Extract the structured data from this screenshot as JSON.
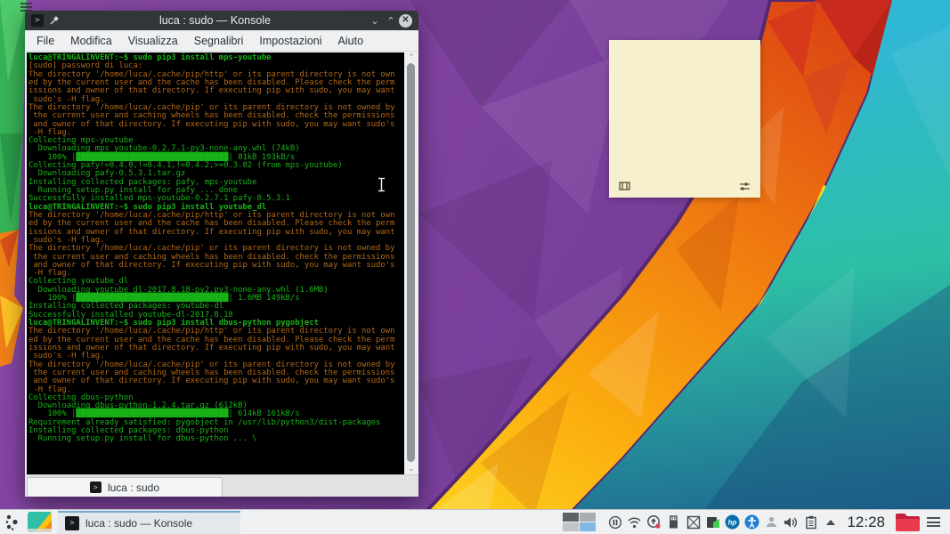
{
  "desktop": {
    "toolbox_icon": "hamburger-icon",
    "wallpaper_colors": {
      "purple": "#7f3f9e",
      "orange": "#f07c10",
      "yellow": "#fdd11d",
      "teal": "#2dbfa6",
      "blue": "#1d5f8e",
      "red": "#c92a1e",
      "green": "#37b457"
    }
  },
  "konsole": {
    "title": "luca : sudo — Konsole",
    "titlebar_buttons": {
      "minimize": "⌄",
      "maximize": "⌃",
      "close": "✕"
    },
    "menu": [
      "File",
      "Modifica",
      "Visualizza",
      "Segnalibri",
      "Impostazioni",
      "Aiuto"
    ],
    "tab_label": "luca : sudo",
    "terminal_lines": [
      {
        "c": "b",
        "t": "luca@TRINGALINVENT:~$ sudo pip3 install mps-youtube"
      },
      {
        "c": "y",
        "t": "[sudo] password di luca:"
      },
      {
        "c": "y",
        "t": "The directory '/home/luca/.cache/pip/http' or its parent directory is not own"
      },
      {
        "c": "y",
        "t": "ed by the current user and the cache has been disabled. Please check the perm"
      },
      {
        "c": "y",
        "t": "issions and owner of that directory. If executing pip with sudo, you may want"
      },
      {
        "c": "y",
        "t": " sudo's -H flag."
      },
      {
        "c": "y",
        "t": "The directory '/home/luca/.cache/pip' or its parent directory is not owned by"
      },
      {
        "c": "y",
        "t": " the current user and caching wheels has been disabled. check the permissions"
      },
      {
        "c": "y",
        "t": " and owner of that directory. If executing pip with sudo, you may want sudo's"
      },
      {
        "c": "y",
        "t": " -H flag."
      },
      {
        "c": "g",
        "t": "Collecting mps-youtube"
      },
      {
        "c": "g",
        "t": "  Downloading mps_youtube-0.2.7.1-py3-none-any.whl (74kB)"
      },
      {
        "c": "g",
        "t": "    100% |████████████████████████████████| 81kB 193kB/s "
      },
      {
        "c": "g",
        "t": "Collecting pafy!=0.4.0,!=0.4.1,!=0.4.2,>=0.3.82 (from mps-youtube)"
      },
      {
        "c": "g",
        "t": "  Downloading pafy-0.5.3.1.tar.gz"
      },
      {
        "c": "g",
        "t": "Installing collected packages: pafy, mps-youtube"
      },
      {
        "c": "g",
        "t": "  Running setup.py install for pafy ... done"
      },
      {
        "c": "g",
        "t": "Successfully installed mps-youtube-0.2.7.1 pafy-0.5.3.1"
      },
      {
        "c": "b",
        "t": "luca@TRINGALINVENT:~$ sudo pip3 install youtube_dl"
      },
      {
        "c": "y",
        "t": "The directory '/home/luca/.cache/pip/http' or its parent directory is not own"
      },
      {
        "c": "y",
        "t": "ed by the current user and the cache has been disabled. Please check the perm"
      },
      {
        "c": "y",
        "t": "issions and owner of that directory. If executing pip with sudo, you may want"
      },
      {
        "c": "y",
        "t": " sudo's -H flag."
      },
      {
        "c": "y",
        "t": "The directory '/home/luca/.cache/pip' or its parent directory is not owned by"
      },
      {
        "c": "y",
        "t": " the current user and caching wheels has been disabled. check the permissions"
      },
      {
        "c": "y",
        "t": " and owner of that directory. If executing pip with sudo, you may want sudo's"
      },
      {
        "c": "y",
        "t": " -H flag."
      },
      {
        "c": "g",
        "t": "Collecting youtube_dl"
      },
      {
        "c": "g",
        "t": "  Downloading youtube_dl-2017.8.18-py2.py3-none-any.whl (1.6MB)"
      },
      {
        "c": "g",
        "t": "    100% |████████████████████████████████| 1.6MB 149kB/s "
      },
      {
        "c": "g",
        "t": "Installing collected packages: youtube-dl"
      },
      {
        "c": "g",
        "t": "Successfully installed youtube-dl-2017.8.18"
      },
      {
        "c": "b",
        "t": "luca@TRINGALINVENT:~$ sudo pip3 install dbus-python pygobject"
      },
      {
        "c": "y",
        "t": "The directory '/home/luca/.cache/pip/http' or its parent directory is not own"
      },
      {
        "c": "y",
        "t": "ed by the current user and the cache has been disabled. Please check the perm"
      },
      {
        "c": "y",
        "t": "issions and owner of that directory. If executing pip with sudo, you may want"
      },
      {
        "c": "y",
        "t": " sudo's -H flag."
      },
      {
        "c": "y",
        "t": "The directory '/home/luca/.cache/pip' or its parent directory is not owned by"
      },
      {
        "c": "y",
        "t": " the current user and caching wheels has been disabled. check the permissions"
      },
      {
        "c": "y",
        "t": " and owner of that directory. If executing pip with sudo, you may want sudo's"
      },
      {
        "c": "y",
        "t": " -H flag."
      },
      {
        "c": "g",
        "t": "Collecting dbus-python"
      },
      {
        "c": "g",
        "t": "  Downloading dbus-python-1.2.4.tar.gz (612kB)"
      },
      {
        "c": "g",
        "t": "    100% |████████████████████████████████| 614kB 161kB/s "
      },
      {
        "c": "g",
        "t": "Requirement already satisfied: pygobject in /usr/lib/python3/dist-packages"
      },
      {
        "c": "g",
        "t": "Installing collected packages: dbus-python"
      },
      {
        "c": "g",
        "t": "  Running setup.py install for dbus-python ... \\"
      }
    ]
  },
  "note": {
    "value": "",
    "icons": [
      "format-toolbar-icon",
      "settings-sliders-icon"
    ]
  },
  "panel": {
    "launcher_icon": "kde-launcher-icon",
    "desktop_icon": "desktop-folder-icon",
    "task_label": "luca : sudo — Konsole",
    "clock": "12:28",
    "tray_icons": [
      "virtual-desktop-pager",
      "pause-icon",
      "wifi-icon",
      "updates-icon",
      "usb-device-icon",
      "frame-icon",
      "recorder-icon",
      "hp-printer-icon",
      "accessibility-icon",
      "user-idle-icon",
      "volume-icon",
      "clipboard-icon",
      "tray-expander-icon",
      "red-folder-icon",
      "panel-menu-icon"
    ]
  }
}
